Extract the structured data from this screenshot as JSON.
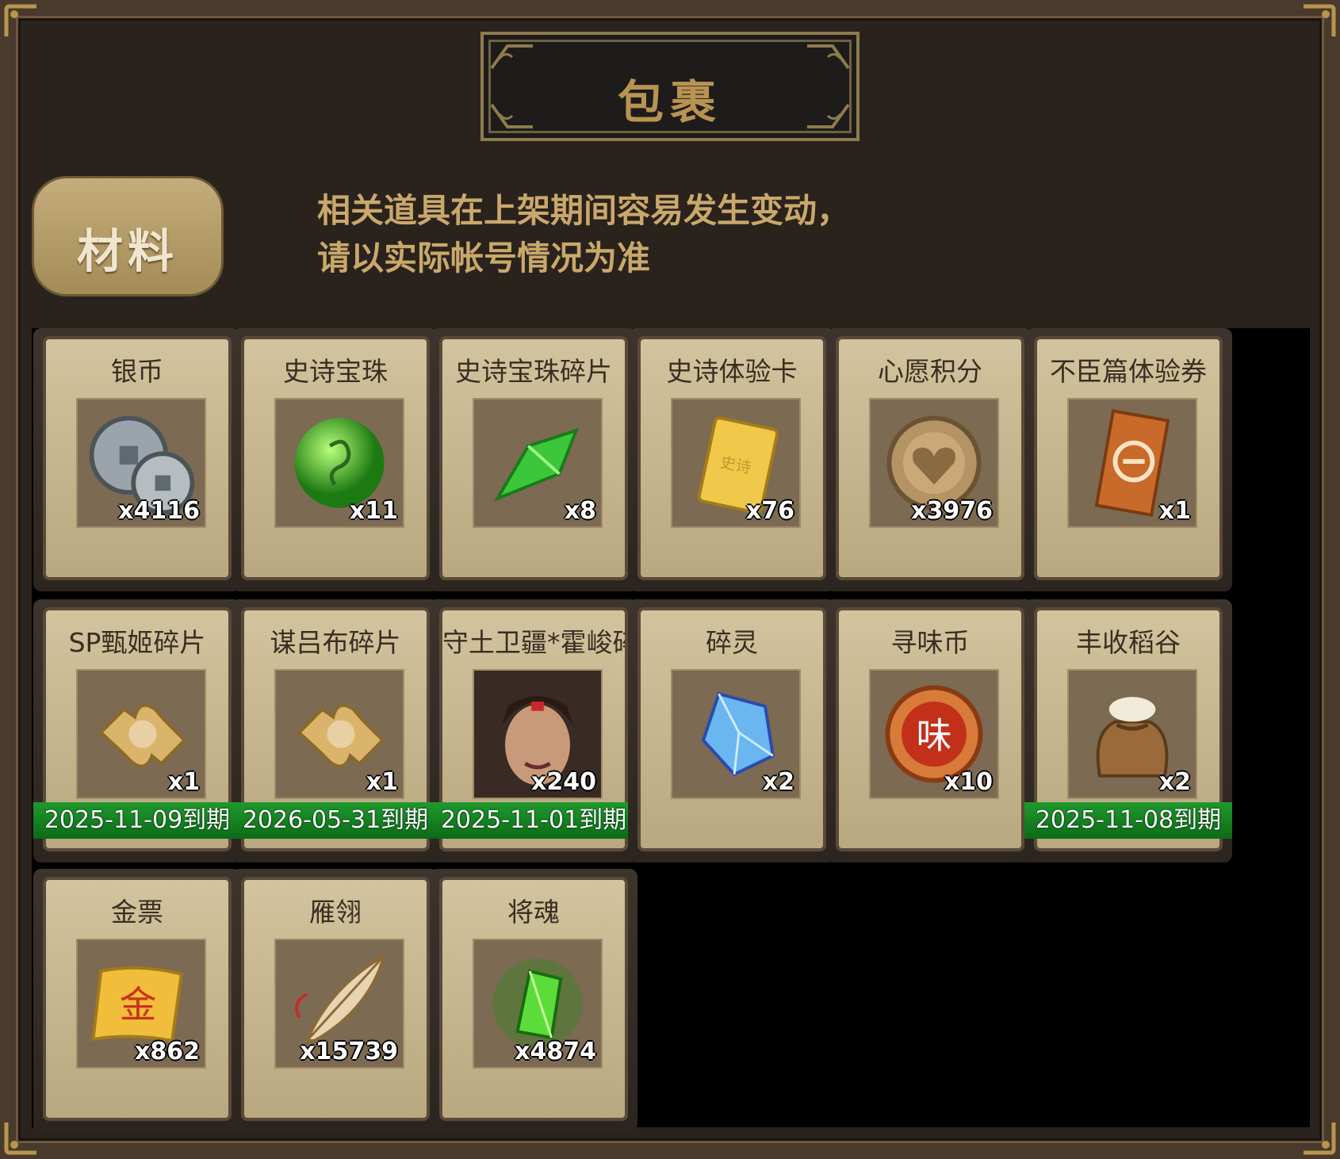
{
  "title": "包裹",
  "tab": {
    "label": "材料"
  },
  "notice": {
    "line1": "相关道具在上架期间容易发生变动，",
    "line2": "请以实际帐号情况为准"
  },
  "items": [
    {
      "name": "银币",
      "count": "x4116",
      "icon": "silver-coin-icon",
      "expiry": ""
    },
    {
      "name": "史诗宝珠",
      "count": "x11",
      "icon": "green-orb-icon",
      "expiry": ""
    },
    {
      "name": "史诗宝珠碎片",
      "count": "x8",
      "icon": "green-shard-icon",
      "expiry": ""
    },
    {
      "name": "史诗体验卡",
      "count": "x76",
      "icon": "gold-card-icon",
      "expiry": ""
    },
    {
      "name": "心愿积分",
      "count": "x3976",
      "icon": "heart-coin-icon",
      "expiry": ""
    },
    {
      "name": "不臣篇体验券",
      "count": "x1",
      "icon": "ticket-icon",
      "expiry": ""
    },
    {
      "name": "SP甄姬碎片",
      "count": "x1",
      "icon": "puzzle-piece-icon",
      "expiry": "2025-11-09到期"
    },
    {
      "name": "谋吕布碎片",
      "count": "x1",
      "icon": "puzzle-piece-icon",
      "expiry": "2026-05-31到期"
    },
    {
      "name": "守土卫疆*霍峻碎片",
      "count": "x240",
      "icon": "hero-portrait-icon",
      "expiry": "2025-11-01到期"
    },
    {
      "name": "碎灵",
      "count": "x2",
      "icon": "blue-crystal-icon",
      "expiry": ""
    },
    {
      "name": "寻味币",
      "count": "x10",
      "icon": "flavor-coin-icon",
      "expiry": ""
    },
    {
      "name": "丰收稻谷",
      "count": "x2",
      "icon": "grain-sack-icon",
      "expiry": "2025-11-08到期"
    },
    {
      "name": "金票",
      "count": "x862",
      "icon": "gold-scroll-icon",
      "expiry": ""
    },
    {
      "name": "雁翎",
      "count": "x15739",
      "icon": "feather-icon",
      "expiry": ""
    },
    {
      "name": "将魂",
      "count": "x4874",
      "icon": "green-soul-crystal-icon",
      "expiry": ""
    }
  ],
  "colors": {
    "expiry_bar": "#1e9a2c",
    "notice_text": "#c9a86b",
    "title_text": "#b89352"
  }
}
